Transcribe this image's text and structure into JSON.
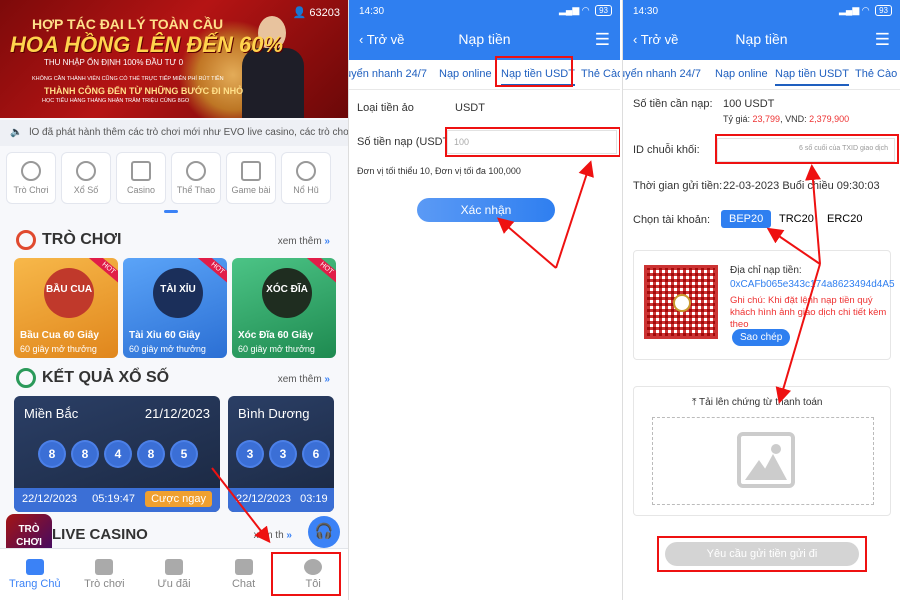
{
  "panel1": {
    "banner": {
      "line1": "HỢP TÁC ĐẠI LÝ TOÀN CẦU",
      "line2": "HOA HỒNG LÊN ĐẾN 60%",
      "line3": "THU NHẬP ỔN ĐỊNH 100% ĐẦU TƯ 0",
      "line4": "KHÔNG CẦN THÀNH VIÊN CŨNG CÓ THỂ TRỰC TIẾP MIỄN PHÍ RÚT TIỀN",
      "line5": "THÀNH CÔNG ĐẾN TỪ NHỮNG BƯỚC ĐI NHỎ",
      "line6": "HỌC TIẾU HÀNG THÁNG NHẬN TRĂM TRIỆU CÙNG 8GO",
      "user_count": "63203"
    },
    "notice": "lO đã phát hành thêm các trò chơi mới như EVO live casino, các trò chơi",
    "categories": [
      "Trò Chơi",
      "Xổ Số",
      "Casino",
      "Thể Thao",
      "Game bài",
      "Nổ Hũ"
    ],
    "games_section": {
      "title": "TRÒ CHƠI",
      "see_more": "xem thêm"
    },
    "games": [
      {
        "art": "BẦU CUA",
        "name": "Bầu Cua 60 Giây",
        "desc": "60 giây mở thưởng",
        "badge": "HOT",
        "color": "#f0a030"
      },
      {
        "art": "TÀI XỈU",
        "name": "Tài Xỉu 60 Giây",
        "desc": "60 giây mở thưởng",
        "badge": "HOT",
        "color": "#3b8ef0"
      },
      {
        "art": "XÓC ĐĨA",
        "name": "Xóc Đĩa 60 Giây",
        "desc": "60 giây mở thưởng",
        "badge": "HOT",
        "color": "#36a96a"
      }
    ],
    "lottery_section": {
      "title": "KẾT QUẢ XỔ SỐ",
      "see_more": "xem thêm"
    },
    "lotteries": [
      {
        "region": "Miền Bắc",
        "date": "21/12/2023",
        "balls": [
          "8",
          "8",
          "4",
          "8",
          "5"
        ],
        "foot_date": "22/12/2023",
        "foot_time": "05:19:47",
        "cta": "Cược ngay"
      },
      {
        "region": "Bình Dương",
        "date": "",
        "balls": [
          "3",
          "3",
          "6"
        ],
        "foot_date": "22/12/2023",
        "foot_time": "03:19",
        "cta": ""
      }
    ],
    "live_title": "LIVE CASINO",
    "live_see_more": "xem th",
    "float_logo": [
      "TRÒ",
      "CHƠI"
    ],
    "tabbar": [
      {
        "label": "Trang Chủ",
        "icon": "home-icon",
        "active": true
      },
      {
        "label": "Trò chơi",
        "icon": "gamepad-icon",
        "active": false
      },
      {
        "label": "Ưu đãi",
        "icon": "gift-icon",
        "active": false
      },
      {
        "label": "Chat",
        "icon": "chat-icon",
        "active": false
      },
      {
        "label": "Tôi",
        "icon": "profile-icon",
        "active": false
      }
    ]
  },
  "panel2": {
    "status_time": "14:30",
    "battery": "93",
    "back": "Trở về",
    "title": "Nạp tiền",
    "subtabs": [
      "uyển nhanh 24/7",
      "Nạp online",
      "Nạp tiền USDT",
      "Thẻ Cào"
    ],
    "currency_label": "Loại tiền ảo",
    "currency_value": "USDT",
    "amount_label": "Số tiền nạp (USDT):",
    "amount_placeholder": "100",
    "limits": "Đơn vị tối thiểu 10, Đơn vị tối đa 100,000",
    "confirm": "Xác nhận"
  },
  "panel3": {
    "status_time": "14:30",
    "battery": "93",
    "back": "Trở về",
    "title": "Nạp tiền",
    "subtabs": [
      "uyển nhanh 24/7",
      "Nạp online",
      "Nạp tiền USDT",
      "Thẻ Cào"
    ],
    "amount_label": "Số tiền cần nạp:",
    "amount_value": "100 USDT",
    "rate_label": "Tỷ giá:",
    "rate_value": "23,799",
    "vnd_label": "VND:",
    "vnd_value": "2,379,900",
    "chain_id_label": "ID chuỗi khối:",
    "chain_id_placeholder": "6 số cuối của TXID giao dịch",
    "time_label": "Thời gian gửi tiền:",
    "time_value": "22-03-2023 Buổi chiều 09:30:03",
    "account_label": "Chọn tài khoản:",
    "chains": [
      "BEP20",
      "TRC20",
      "ERC20"
    ],
    "address_label": "Địa chỉ nạp tiền:",
    "address_value": "0xCAFb065e343c174a8623494d4A5",
    "note": "Ghi chú: Khi đặt lệnh nạp tiền quý khách hình ảnh giao dịch chi tiết kèm theo",
    "copy": "Sao chép",
    "upload_label": "Tải lên chứng từ thanh toán",
    "request": "Yêu cầu gửi tiền gửi đi"
  },
  "colors": {
    "primary": "#2f7ff0",
    "annotation": "#ee1111",
    "banner": "#b51414"
  }
}
